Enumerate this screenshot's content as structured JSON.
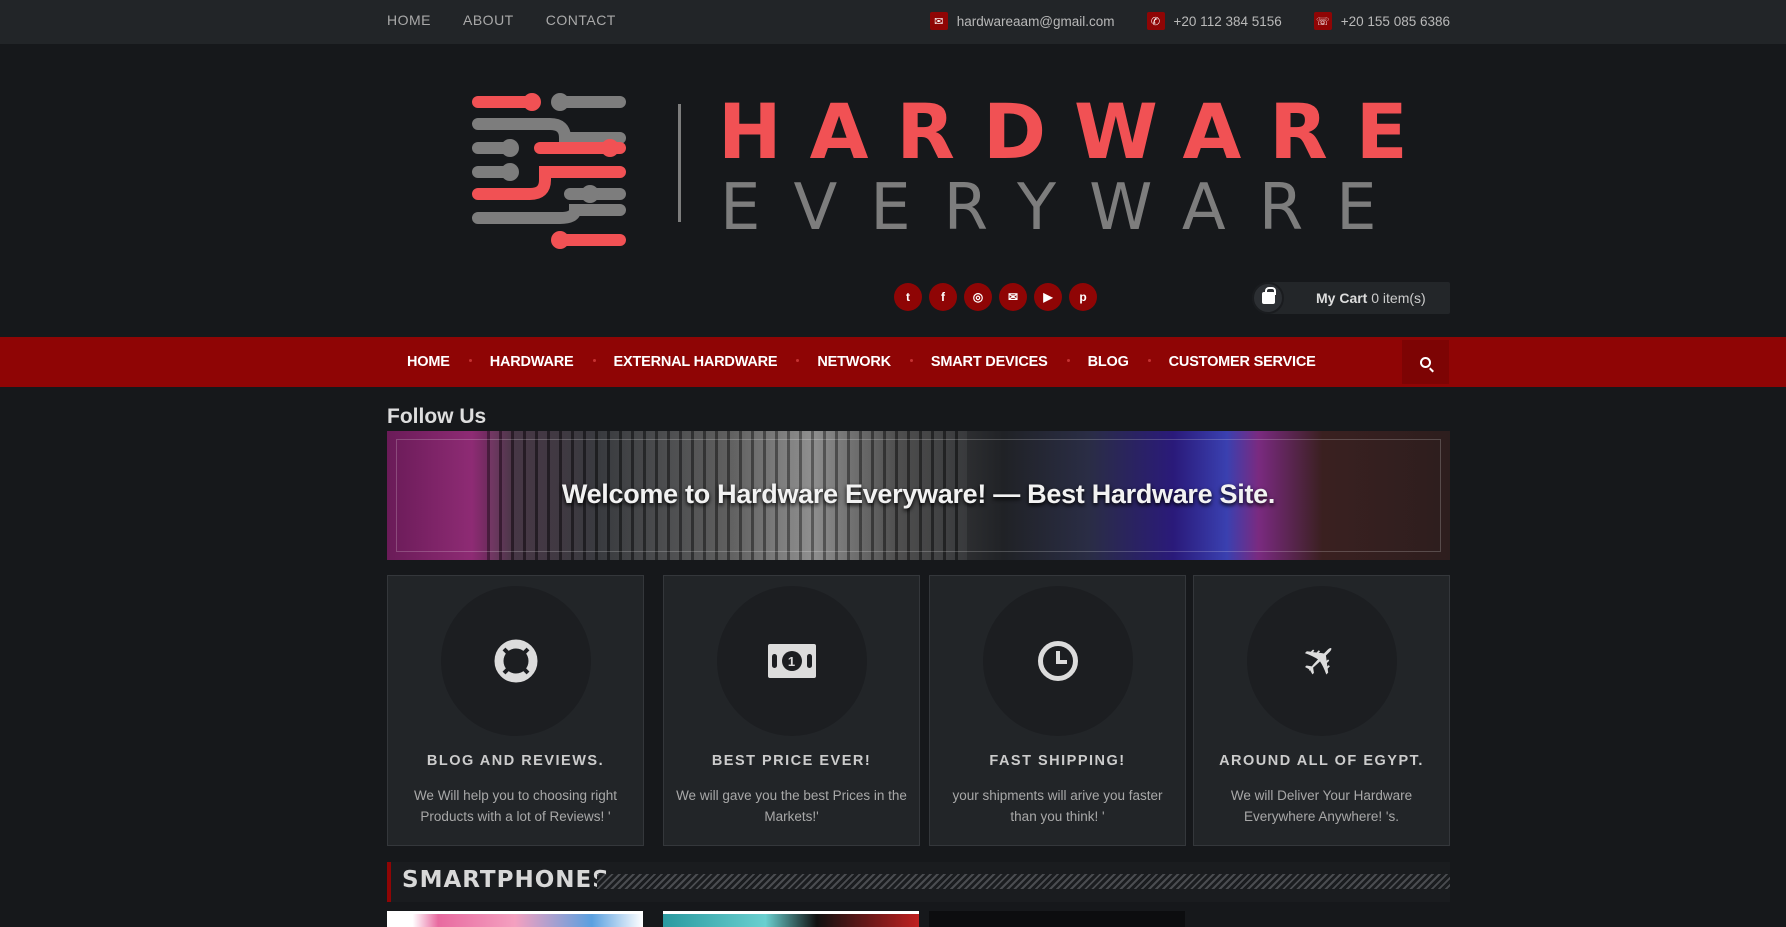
{
  "topbar": {
    "nav": [
      "HOME",
      "ABOUT",
      "CONTACT"
    ],
    "email": "hardwareaam@gmail.com",
    "phone1": "+20 112 384 5156",
    "phone2": "+20 155 085 6386"
  },
  "logo": {
    "word1": "HARDWARE",
    "word2": "EVERYWARE"
  },
  "social": [
    "twitter-icon",
    "facebook-icon",
    "instagram-icon",
    "envelope-icon",
    "youtube-icon",
    "pinterest-icon"
  ],
  "cart": {
    "label": "My Cart",
    "count": "0 item(s)"
  },
  "mainnav": [
    "HOME",
    "HARDWARE",
    "EXTERNAL HARDWARE",
    "NETWORK",
    "SMART DEVICES",
    "BLOG",
    "CUSTOMER SERVICE"
  ],
  "follow_us": "Follow Us",
  "banner": {
    "text": "Welcome to Hardware Everyware! — Best Hardware Site."
  },
  "features": [
    {
      "icon": "lifebuoy-icon",
      "title": "BLOG AND REVIEWS.",
      "desc": "We Will help you to choosing right Products with a lot of Reviews! '"
    },
    {
      "icon": "money-icon",
      "title": "BEST PRICE EVER!",
      "desc": "We will gave you the best Prices in the Markets!'"
    },
    {
      "icon": "clock-icon",
      "title": "FAST SHIPPING!",
      "desc": "your shipments will arive you faster than you think! '"
    },
    {
      "icon": "plane-icon",
      "title": "AROUND ALL OF EGYPT.",
      "desc": "We will Deliver Your Hardware Everywhere Anywhere! 's."
    }
  ],
  "section": {
    "title": "SMARTPHONES"
  },
  "colors": {
    "brand_red": "#8f0505",
    "logo_red": "#f15154",
    "background": "#16181b"
  }
}
